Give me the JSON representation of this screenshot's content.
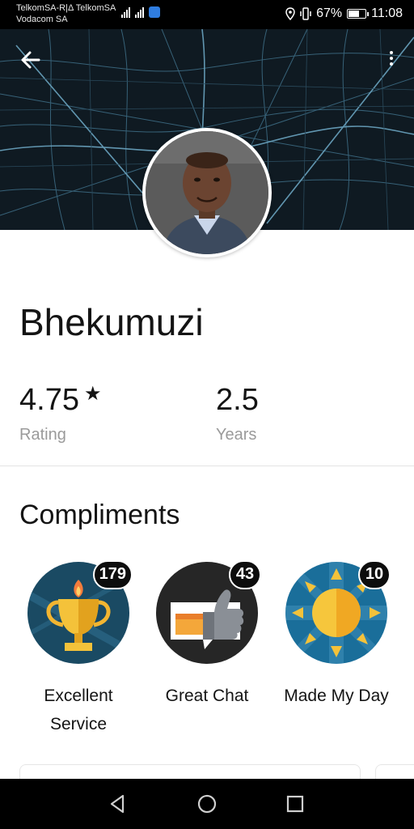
{
  "status_bar": {
    "carrier_line1": "TelkomSA-R|Δ TelkomSA",
    "carrier_line2": "Vodacom SA",
    "battery": "67%",
    "time": "11:08",
    "icons": [
      "signal-icon",
      "signal-icon",
      "shield-icon",
      "location-icon",
      "vibrate-icon",
      "battery-icon"
    ]
  },
  "header": {
    "back_icon": "arrow-left-icon",
    "menu_icon": "more-vertical-icon"
  },
  "profile": {
    "name": "Bhekumuzi",
    "rating_value": "4.75",
    "rating_star": "★",
    "rating_label": "Rating",
    "years_value": "2.5",
    "years_label": "Years"
  },
  "compliments": {
    "title": "Compliments",
    "items": [
      {
        "label_line1": "Excellent",
        "label_line2": "Service",
        "count": "179",
        "icon": "trophy-icon",
        "color": "#1a4a63"
      },
      {
        "label_line1": "Great Chat",
        "label_line2": "",
        "count": "43",
        "icon": "thumbs-up-icon",
        "color": "#262626"
      },
      {
        "label_line1": "Made My Day",
        "label_line2": "",
        "count": "10",
        "icon": "sun-icon",
        "color": "#1a6e9a"
      }
    ]
  },
  "nav_bar": {
    "buttons": [
      "back-triangle-icon",
      "home-circle-icon",
      "recents-square-icon"
    ]
  },
  "colors": {
    "map_bg": "#0f1a22",
    "map_roads": "#3f6f88",
    "badge_bg": "#0d0d0d",
    "muted_text": "#9a9a9a"
  }
}
